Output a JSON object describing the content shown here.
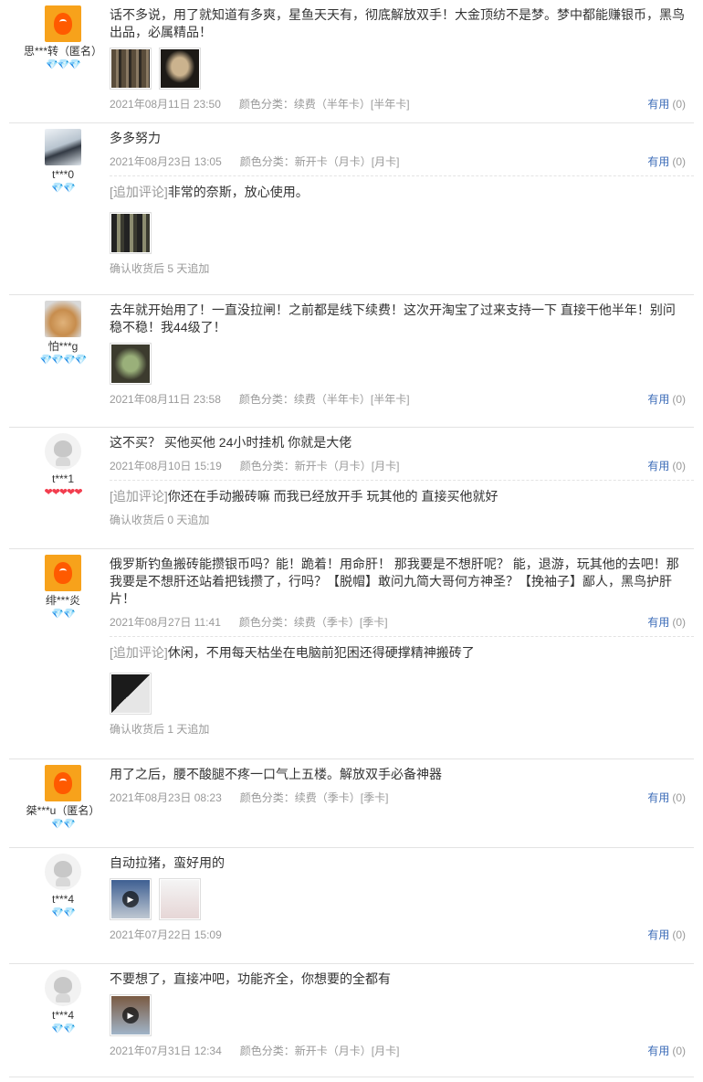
{
  "reviews": [
    {
      "user": "思***转（匿名）",
      "avatar": "orange",
      "rank": "💎💎💎",
      "rank_style": "blue",
      "text": "话不多说，用了就知道有多爽，星鱼天天有，彻底解放双手！大金顶纺不是梦。梦中都能赚银币，黑鸟出品，必属精品！",
      "images": [
        "t1",
        "t2"
      ],
      "date": "2021年08月11日 23:50",
      "sku": "颜色分类：续费（半年卡）[半年卡]",
      "useful": "有用",
      "useful_count": "(0)",
      "append": null
    },
    {
      "user": "t***0",
      "avatar": "photo",
      "rank": "💎💎",
      "rank_style": "blue",
      "text": "多多努力",
      "images": [],
      "date": "2021年08月23日 13:05",
      "sku": "颜色分类：新开卡（月卡）[月卡]",
      "useful": "有用",
      "useful_count": "(0)",
      "append": {
        "tag": "[追加评论]",
        "text": "非常的奈斯，放心使用。",
        "images": [
          "t3"
        ],
        "tip": "确认收货后 5 天追加"
      }
    },
    {
      "user": "怕***g",
      "avatar": "dog",
      "rank": "💎💎💎💎",
      "rank_style": "blue",
      "text": "去年就开始用了！一直没拉闸！之前都是线下续费！这次开淘宝了过来支持一下 直接干他半年！别问稳不稳！我44级了！",
      "images": [
        "t4"
      ],
      "date": "2021年08月11日 23:58",
      "sku": "颜色分类：续费（半年卡）[半年卡]",
      "useful": "有用",
      "useful_count": "(0)",
      "append": null
    },
    {
      "user": "t***1",
      "avatar": "gray",
      "rank": "❤❤❤❤❤",
      "rank_style": "red",
      "text": "这不买？ 买他买他 24小时挂机 你就是大佬",
      "images": [],
      "date": "2021年08月10日 15:19",
      "sku": "颜色分类：新开卡（月卡）[月卡]",
      "useful": "有用",
      "useful_count": "(0)",
      "append": {
        "tag": "[追加评论]",
        "text": "你还在手动搬砖嘛 而我已经放开手 玩其他的 直接买他就好",
        "images": [],
        "tip": "确认收货后 0 天追加"
      }
    },
    {
      "user": "绯***炎",
      "avatar": "orange",
      "rank": "💎💎",
      "rank_style": "blue",
      "text": "俄罗斯钓鱼搬砖能攒银币吗？能！跪着！用命肝！ 那我要是不想肝呢？ 能，退游，玩其他的去吧！那我要是不想肝还站着把钱攒了，行吗？【脱帽】敢问九简大哥何方神圣？【挽袖子】鄙人，黑鸟护肝片！",
      "images": [],
      "date": "2021年08月27日 11:41",
      "sku": "颜色分类：续费（季卡）[季卡]",
      "useful": "有用",
      "useful_count": "(0)",
      "append": {
        "tag": "[追加评论]",
        "text": "休闲，不用每天枯坐在电脑前犯困还得硬撑精神搬砖了",
        "images": [
          "t5"
        ],
        "tip": "确认收货后 1 天追加"
      }
    },
    {
      "user": "桀***u（匿名）",
      "avatar": "orange",
      "rank": "💎💎",
      "rank_style": "blue",
      "text": "用了之后，腰不酸腿不疼一口气上五楼。解放双手必备神器",
      "images": [],
      "date": "2021年08月23日 08:23",
      "sku": "颜色分类：续费（季卡）[季卡]",
      "useful": "有用",
      "useful_count": "(0)",
      "append": null
    },
    {
      "user": "t***4",
      "avatar": "gray",
      "rank": "💎💎",
      "rank_style": "blue",
      "text": "自动拉猪，蛮好用的",
      "images": [
        "t6v",
        "t7"
      ],
      "date": "2021年07月22日 15:09",
      "sku": "",
      "useful": "有用",
      "useful_count": "(0)",
      "append": null
    },
    {
      "user": "t***4",
      "avatar": "gray",
      "rank": "💎💎",
      "rank_style": "blue",
      "text": "不要想了，直接冲吧，功能齐全，你想要的全都有",
      "images": [
        "t8v"
      ],
      "date": "2021年07月31日 12:34",
      "sku": "颜色分类：新开卡（月卡）[月卡]",
      "useful": "有用",
      "useful_count": "(0)",
      "append": null
    }
  ],
  "icons": {
    "play": "play-icon",
    "rank_blue": "diamond-icon",
    "rank_red": "heart-icon"
  }
}
